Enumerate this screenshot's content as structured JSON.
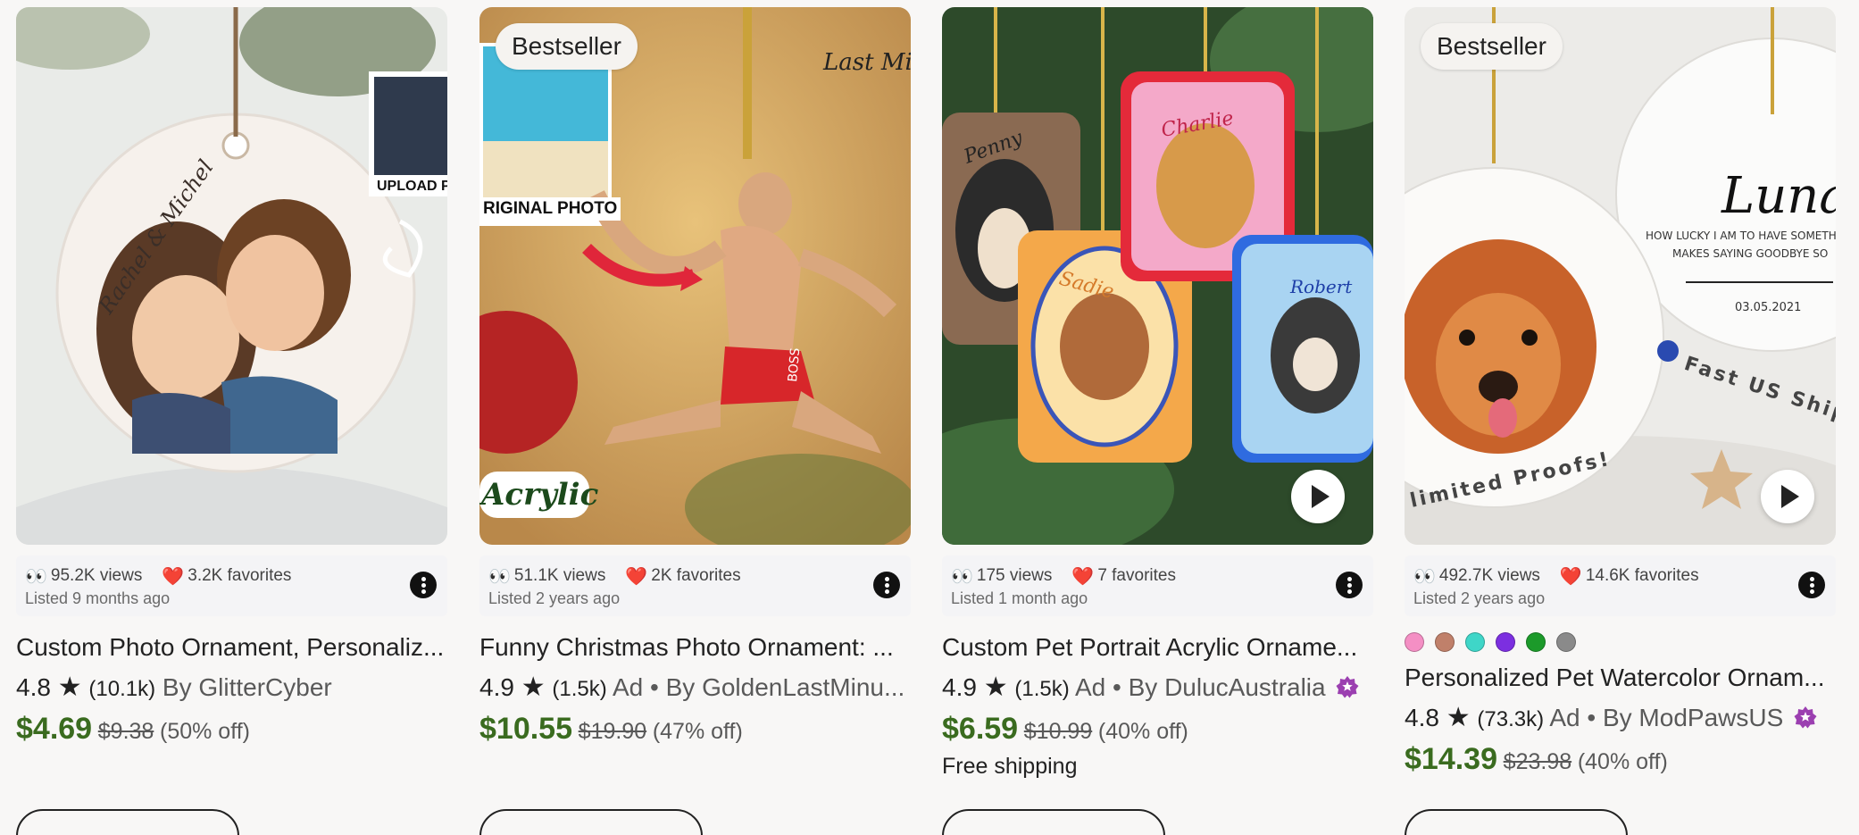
{
  "products": [
    {
      "badge": "",
      "views": "95.2K views",
      "favorites": "3.2K favorites",
      "listed": "Listed 9 months ago",
      "title": "Custom Photo Ornament, Personaliz...",
      "rating": "4.8",
      "reviews": "(10.1k)",
      "ad": "",
      "shop": "By GlitterCyber",
      "star_seller": false,
      "price": "$4.69",
      "original_price": "$9.38",
      "discount": "(50% off)",
      "free_shipping": "",
      "has_video": false,
      "image_caption": "UPLOAD PHO",
      "image_script": "Rachel & Michel"
    },
    {
      "badge": "Bestseller",
      "views": "51.1K views",
      "favorites": "2K favorites",
      "listed": "Listed 2 years ago",
      "title": "Funny Christmas Photo Ornament: ...",
      "rating": "4.9",
      "reviews": "(1.5k)",
      "ad": "Ad •",
      "shop": "By GoldenLastMinu...",
      "star_seller": false,
      "price": "$10.55",
      "original_price": "$19.90",
      "discount": "(47% off)",
      "free_shipping": "",
      "has_video": false,
      "image_caption": "RIGINAL PHOTO",
      "image_script": "Acrylic",
      "image_corner": "Last Minute GIFTS",
      "image_shorts": "BOSS"
    },
    {
      "badge": "",
      "views": "175 views",
      "favorites": "7 favorites",
      "listed": "Listed 1 month ago",
      "title": "Custom Pet Portrait Acrylic Orname...",
      "rating": "4.9",
      "reviews": "(1.5k)",
      "ad": "Ad •",
      "shop": "By DulucAustralia",
      "star_seller": true,
      "price": "$6.59",
      "original_price": "$10.99",
      "discount": "(40% off)",
      "free_shipping": "Free shipping",
      "has_video": true,
      "pet_names": [
        "Penny",
        "Charlie",
        "Sadie",
        "Robert"
      ]
    },
    {
      "badge": "Bestseller",
      "views": "492.7K views",
      "favorites": "14.6K favorites",
      "listed": "Listed 2 years ago",
      "title": "Personalized Pet Watercolor Ornam...",
      "rating": "4.8",
      "reviews": "(73.3k)",
      "ad": "Ad •",
      "shop": "By ModPawsUS",
      "star_seller": true,
      "price": "$14.39",
      "original_price": "$23.98",
      "discount": "(40% off)",
      "free_shipping": "",
      "has_video": true,
      "swatches": [
        "#f48fc4",
        "#c0806a",
        "#3fd6c8",
        "#7c2fe0",
        "#1c9a2a",
        "#8a8a8a"
      ],
      "image_name": "Luna",
      "image_quote_1": "HOW LUCKY I AM TO HAVE SOMETH",
      "image_quote_2": "MAKES SAYING GOODBYE SO",
      "image_date": "03.05.2021",
      "image_arc_1": "Fast US Ship",
      "image_arc_2": "limited Proofs!"
    }
  ],
  "icons": {
    "views": "eyes-icon",
    "favorites": "heart-icon",
    "more": "more-options-icon",
    "rating": "star-icon",
    "star_seller": "star-seller-badge-icon",
    "play": "play-icon"
  }
}
